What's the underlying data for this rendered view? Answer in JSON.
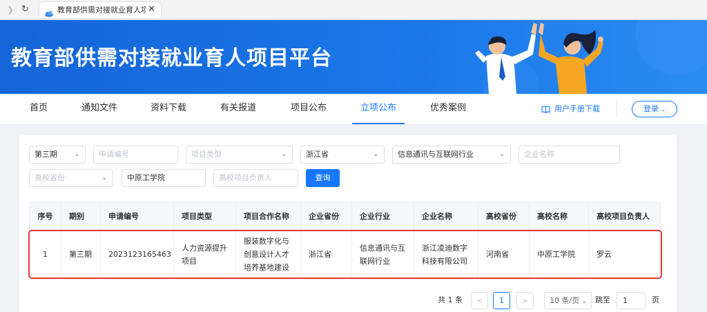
{
  "browser": {
    "forward_icon": "chevron-right-icon",
    "reload_icon": "reload-icon",
    "tab_title": "教育部供需对接就业育人项目",
    "tab_close": "✕"
  },
  "banner": {
    "title": "教育部供需对接就业育人项目平台"
  },
  "nav": {
    "items": [
      "首页",
      "通知文件",
      "资料下载",
      "有关报道",
      "项目公布",
      "立项公布",
      "优秀案例"
    ],
    "active": "立项公布",
    "manual_link": "用户手册下载",
    "login_label": "登录"
  },
  "filters": {
    "period": "第三期",
    "application_no_placeholder": "申请编号",
    "project_type_placeholder": "项目类型",
    "company_province": "浙江省",
    "industry": "信息通讯与互联网行业",
    "company_name_placeholder": "企业名称",
    "school_province_placeholder": "高校省份",
    "school_name": "中原工学院",
    "school_leader_placeholder": "高校项目负责人",
    "query_label": "查询"
  },
  "table": {
    "headers": [
      "序号",
      "期别",
      "申请编号",
      "项目类型",
      "项目合作名称",
      "企业省份",
      "企业行业",
      "企业名称",
      "高校省份",
      "高校名称",
      "高校项目负责人"
    ],
    "rows": [
      [
        "1",
        "第三期",
        "2023123165463",
        "人力资源提升项目",
        "服装数字化与创意设计人才培养基地建设",
        "浙江省",
        "信息通讯与互联网行业",
        "浙江凌迪数字科技有限公司",
        "河南省",
        "中原工学院",
        "罗云"
      ]
    ]
  },
  "pagination": {
    "total": "共 1 条",
    "prev": "<",
    "current": "1",
    "next": ">",
    "page_size": "10 条/页",
    "jump_label": "跳至",
    "jump_value": "1",
    "page_unit": "页"
  },
  "colors": {
    "primary": "#1677ff",
    "banner": "#1a6fe3",
    "highlight": "#e53935"
  }
}
